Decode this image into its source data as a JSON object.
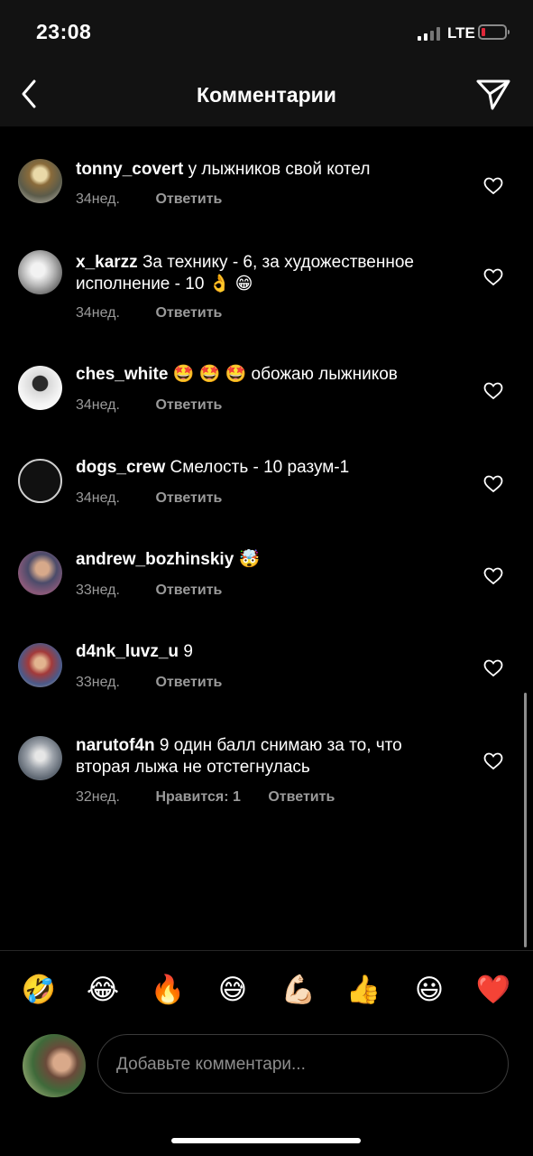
{
  "status_bar": {
    "time": "23:08",
    "network": "LTE"
  },
  "header": {
    "title": "Комментарии",
    "back_icon": "chevron-left-icon",
    "send_icon": "paper-plane-icon"
  },
  "comments": [
    {
      "username": "tonny_covert",
      "text": "у лыжников свой котел",
      "ago": "34нед.",
      "reply": "Ответить"
    },
    {
      "username": "x_karzz",
      "text": "За технику - 6, за художественное исполнение - 10 👌 😁",
      "ago": "34нед.",
      "reply": "Ответить"
    },
    {
      "username": "ches_white",
      "text": "🤩 🤩 🤩 обожаю лыжников",
      "ago": "34нед.",
      "reply": "Ответить"
    },
    {
      "username": "dogs_crew",
      "text": "Смелость - 10 разум-1",
      "ago": "34нед.",
      "reply": "Ответить"
    },
    {
      "username": "andrew_bozhinskiy",
      "text": "🤯",
      "ago": "33нед.",
      "reply": "Ответить"
    },
    {
      "username": "d4nk_luvz_u",
      "text": "9",
      "ago": "33нед.",
      "reply": "Ответить"
    },
    {
      "username": "narutof4n",
      "text": "9 один балл снимаю за то, что вторая лыжа не отстегнулась",
      "ago": "32нед.",
      "likes": "Нравится: 1",
      "reply": "Ответить"
    }
  ],
  "emoji_bar": [
    "🤣",
    "😂",
    "🔥",
    "😅",
    "💪🏻",
    "👍",
    "😃",
    "❤️"
  ],
  "composer": {
    "placeholder": "Добавьте комментари..."
  },
  "colors": {
    "background": "#000000",
    "bar": "#121212",
    "meta_text": "#9a9a9a",
    "battery_low": "#e0283a"
  }
}
